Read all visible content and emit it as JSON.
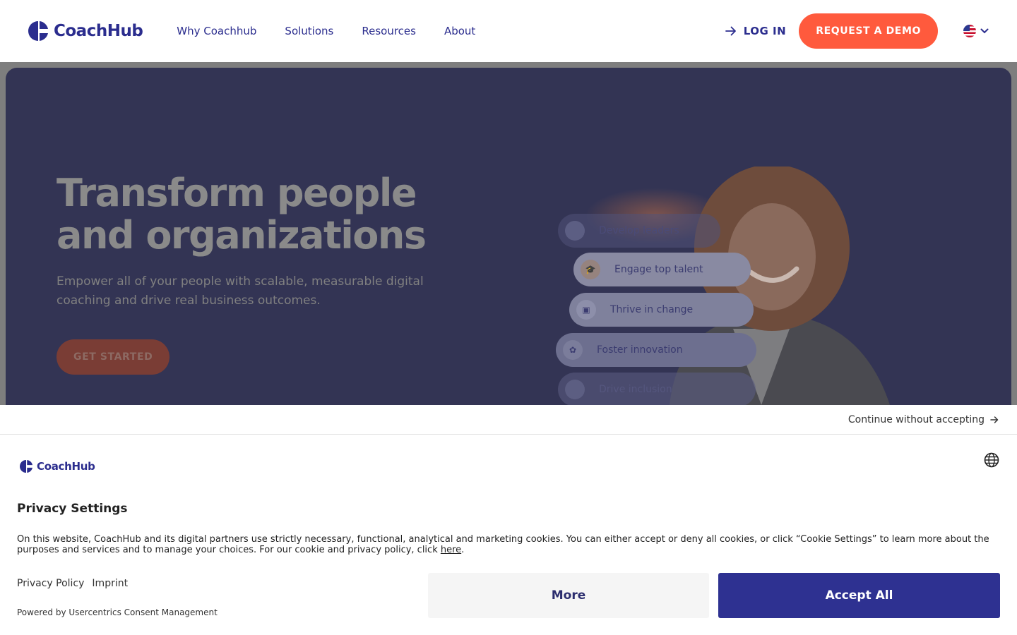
{
  "header": {
    "logo_text": "CoachHub",
    "nav": [
      "Why Coachhub",
      "Solutions",
      "Resources",
      "About"
    ],
    "login_label": "LOG IN",
    "demo_label": "REQUEST A DEMO",
    "language_icon": "us-flag-icon"
  },
  "hero": {
    "title": "Transform people and organizations",
    "subtitle": "Empower all of your people with scalable, measurable digital coaching and drive real business outcomes.",
    "cta_label": "GET STARTED",
    "pills": [
      {
        "label": "Develop leaders",
        "icon": "target-icon"
      },
      {
        "label": "Engage top talent",
        "icon": "graduation-cap-icon"
      },
      {
        "label": "Thrive in change",
        "icon": "document-icon"
      },
      {
        "label": "Foster innovation",
        "icon": "lotus-icon"
      },
      {
        "label": "Drive inclusion",
        "icon": "person-icon"
      }
    ]
  },
  "cookie_banner": {
    "continue_label": "Continue without accepting",
    "logo_text": "CoachHub",
    "title": "Privacy Settings",
    "body": "On this website, CoachHub and its digital partners use strictly necessary, functional, analytical and marketing cookies. You can either accept or deny all cookies, or click “Cookie Settings” to learn more about the purposes and services and to manage your choices. For our cookie and privacy policy, click ",
    "body_link": "here",
    "body_end": ".",
    "privacy_policy_label": "Privacy Policy",
    "imprint_label": "Imprint",
    "powered_by": "Powered by Usercentrics Consent Management",
    "more_label": "More",
    "accept_label": "Accept All"
  },
  "colors": {
    "brand": "#2b2d8e",
    "accent": "#ff5a3d",
    "hero_overlay": "#333454",
    "accept": "#2e3191"
  }
}
